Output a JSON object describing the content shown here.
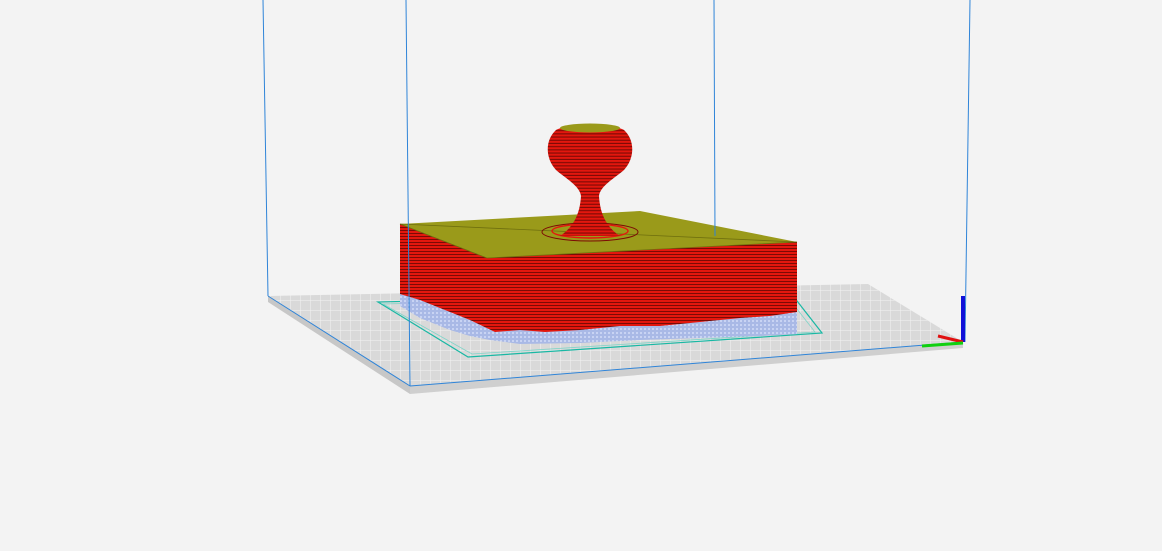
{
  "scene": {
    "background_color": "#f3f3f3",
    "build_volume_line_color": "#2f84d8",
    "plate_color": "#d9d9d9",
    "plate_grid_color": "#ffffff",
    "skirt_color": "#19b8a4",
    "support_color": "#a9b9e6",
    "model_wall_color": "#e3170e",
    "model_layer_line_color": "#7c0a05",
    "model_top_color": "#9a9a1a",
    "axis_colors": {
      "x": "#e01010",
      "y": "#10d010",
      "z": "#1010d8"
    }
  }
}
